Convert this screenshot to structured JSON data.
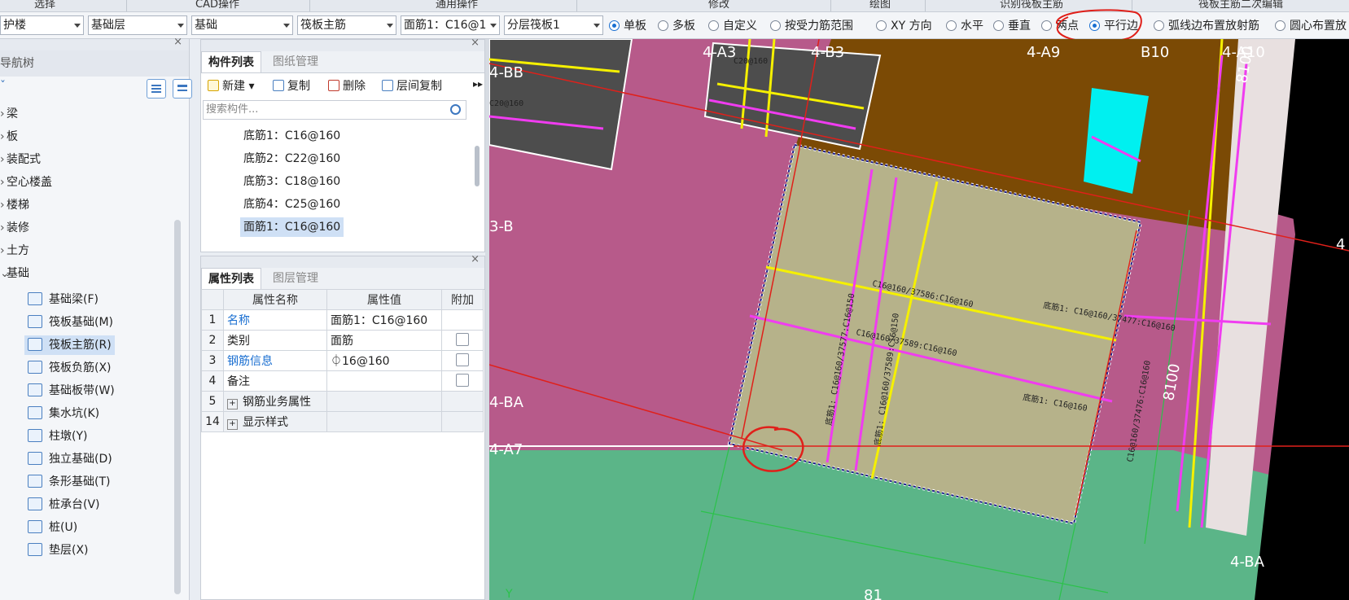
{
  "ribbon": {
    "groups": [
      "选择",
      "CAD操作",
      "通用操作",
      "修改",
      "绘图",
      "识别筏板主筋",
      "筏板主筋二次编辑"
    ]
  },
  "toolbar": {
    "floor": "护楼",
    "layer": "基础层",
    "category": "基础",
    "type": "筏板主筋",
    "component": "面筋1：C16@1",
    "subtype": "分层筏板1",
    "radios": [
      {
        "label": "单板",
        "checked": true
      },
      {
        "label": "多板",
        "checked": false
      },
      {
        "label": "自定义",
        "checked": false
      },
      {
        "label": "按受力筋范围",
        "checked": false
      },
      {
        "label": "XY 方向",
        "checked": false
      },
      {
        "label": "水平",
        "checked": false
      },
      {
        "label": "垂直",
        "checked": false
      },
      {
        "label": "两点",
        "checked": true
      },
      {
        "label": "平行边",
        "checked": false
      },
      {
        "label": "弧线边布置放射筋",
        "checked": false
      },
      {
        "label": "圆心布置放",
        "checked": false
      }
    ]
  },
  "nav": {
    "title": "导航树",
    "items": [
      "梁",
      "板",
      "装配式",
      "空心楼盖",
      "楼梯",
      "装修",
      "土方",
      "基础"
    ],
    "sub_items": [
      {
        "label": "基础梁(F)",
        "selected": false
      },
      {
        "label": "筏板基础(M)",
        "selected": false
      },
      {
        "label": "筏板主筋(R)",
        "selected": true
      },
      {
        "label": "筏板负筋(X)",
        "selected": false
      },
      {
        "label": "基础板带(W)",
        "selected": false
      },
      {
        "label": "集水坑(K)",
        "selected": false
      },
      {
        "label": "柱墩(Y)",
        "selected": false
      },
      {
        "label": "独立基础(D)",
        "selected": false
      },
      {
        "label": "条形基础(T)",
        "selected": false
      },
      {
        "label": "桩承台(V)",
        "selected": false
      },
      {
        "label": "桩(U)",
        "selected": false
      },
      {
        "label": "垫层(X)",
        "selected": false
      }
    ]
  },
  "component_list": {
    "tabs": [
      "构件列表",
      "图纸管理"
    ],
    "buttons": [
      "新建",
      "复制",
      "删除",
      "层间复制"
    ],
    "search_placeholder": "搜索构件...",
    "items": [
      {
        "label": "底筋1：C16@160",
        "selected": false
      },
      {
        "label": "底筋2：C22@160",
        "selected": false
      },
      {
        "label": "底筋3：C18@160",
        "selected": false
      },
      {
        "label": "底筋4：C25@160",
        "selected": false
      },
      {
        "label": "面筋1：C16@160",
        "selected": true
      }
    ]
  },
  "properties": {
    "tabs": [
      "属性列表",
      "图层管理"
    ],
    "headers": [
      "属性名称",
      "属性值",
      "附加"
    ],
    "rows": [
      {
        "num": "1",
        "name": "名称",
        "value": "面筋1：C16@160"
      },
      {
        "num": "2",
        "name": "类别",
        "value": "面筋"
      },
      {
        "num": "3",
        "name": "钢筋信息",
        "value": "⏀16@160"
      },
      {
        "num": "4",
        "name": "备注",
        "value": ""
      },
      {
        "num": "5",
        "name": "钢筋业务属性",
        "value": ""
      },
      {
        "num": "14",
        "name": "显示样式",
        "value": ""
      }
    ]
  },
  "canvas": {
    "grid_labels": [
      "4-A3",
      "4-B3",
      "4-A9",
      "B10",
      "4-A10",
      "4-BB",
      "3-B",
      "4-BA",
      "4-A7",
      "4-BA",
      "4"
    ],
    "dimension_labels": [
      "8100",
      "8100",
      "81"
    ],
    "rebar_texts": [
      "C16@160/37586:C16@160",
      "C16@160/37589:C16@160",
      "底筋1: C16@160/37477:C16@160",
      "底筋1: C16@160",
      "C16@160/37476:C16@160",
      "底筋1: C16@160/37577:C16@150",
      "底筋1: C16@160/37589:C16@150",
      "C20@160",
      "C20@160"
    ],
    "axis_label": "Y",
    "colors": {
      "slab_magenta": "#b75a8a",
      "slab_brown": "#7b4a05",
      "slab_green": "#5bb588",
      "slab_khaki": "#b6b28a",
      "slab_grey": "#4d4d4d",
      "rebar_yellow": "#f5f000",
      "rebar_magenta": "#f03cf0",
      "annotation_red": "#e0201a",
      "cyan_patch": "#00f0f0"
    }
  }
}
